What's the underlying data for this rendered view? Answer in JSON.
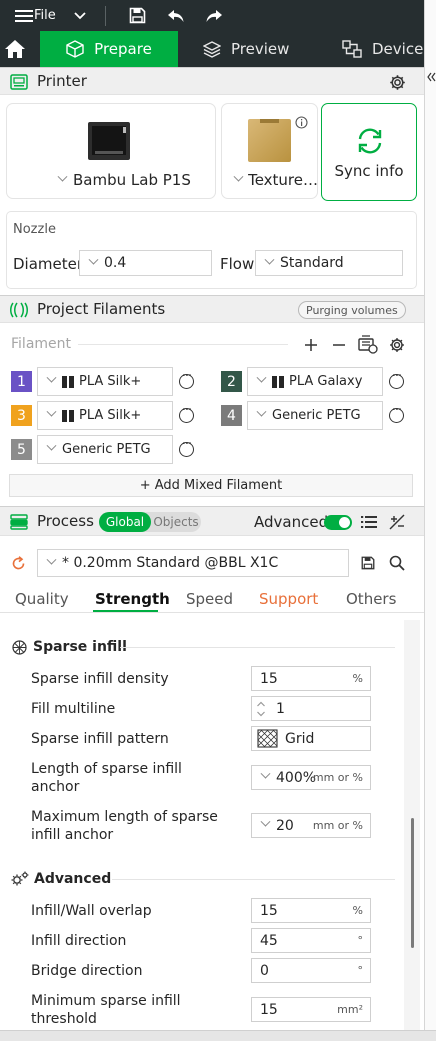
{
  "titlebar": {
    "file_label": "File"
  },
  "tabs": [
    {
      "label": "Prepare"
    },
    {
      "label": "Preview"
    },
    {
      "label": "Device"
    }
  ],
  "printer": {
    "title": "Printer",
    "printer_name": "Bambu Lab P1S",
    "plate_name": "Texture…",
    "sync_label": "Sync info",
    "nozzle_title": "Nozzle",
    "diameter_label": "Diameter",
    "diameter_value": "0.4",
    "flow_label": "Flow",
    "flow_value": "Standard"
  },
  "filaments": {
    "title": "Project Filaments",
    "purging_label": "Purging volumes",
    "filament_label": "Filament",
    "items": [
      {
        "num": "1",
        "name": "PLA Silk+",
        "color": "#6a52c5"
      },
      {
        "num": "2",
        "name": "PLA Galaxy",
        "color": "#335749"
      },
      {
        "num": "3",
        "name": "PLA Silk+",
        "color": "#f0a21e"
      },
      {
        "num": "4",
        "name": "Generic PETG",
        "color": "#7b7b7b"
      },
      {
        "num": "5",
        "name": "Generic PETG",
        "color": "#8c8c8c"
      }
    ],
    "add_mixed_label": "+ Add Mixed Filament"
  },
  "process": {
    "title": "Process",
    "global_label": "Global",
    "objects_label": "Objects",
    "advanced_label": "Advanced",
    "profile_name": "* 0.20mm Standard @BBL X1C",
    "tabs": [
      "Quality",
      "Strength",
      "Speed",
      "Support",
      "Others"
    ],
    "active_tab": "Strength"
  },
  "settings": {
    "sparse_title": "Sparse infill",
    "density_label": "Sparse infill density",
    "density_value": "15",
    "density_unit": "%",
    "multiline_label": "Fill multiline",
    "multiline_value": "1",
    "pattern_label": "Sparse infill pattern",
    "pattern_value": "Grid",
    "anchor_label": "Length of sparse infill anchor",
    "anchor_value": "400%",
    "anchor_unit": "mm or %",
    "max_anchor_label": "Maximum length of sparse infill anchor",
    "max_anchor_value": "20",
    "max_anchor_unit": "mm or %",
    "advanced_title": "Advanced",
    "overlap_label": "Infill/Wall overlap",
    "overlap_value": "15",
    "overlap_unit": "%",
    "direction_label": "Infill direction",
    "direction_value": "45",
    "direction_unit": "°",
    "bridge_label": "Bridge direction",
    "bridge_value": "0",
    "bridge_unit": "°",
    "threshold_label": "Minimum sparse infill threshold",
    "threshold_value": "15",
    "threshold_unit": "mm²"
  },
  "colors": {
    "accent": "#00ae42",
    "titlebar": "#262e30",
    "support_tab": "#e8703a"
  }
}
